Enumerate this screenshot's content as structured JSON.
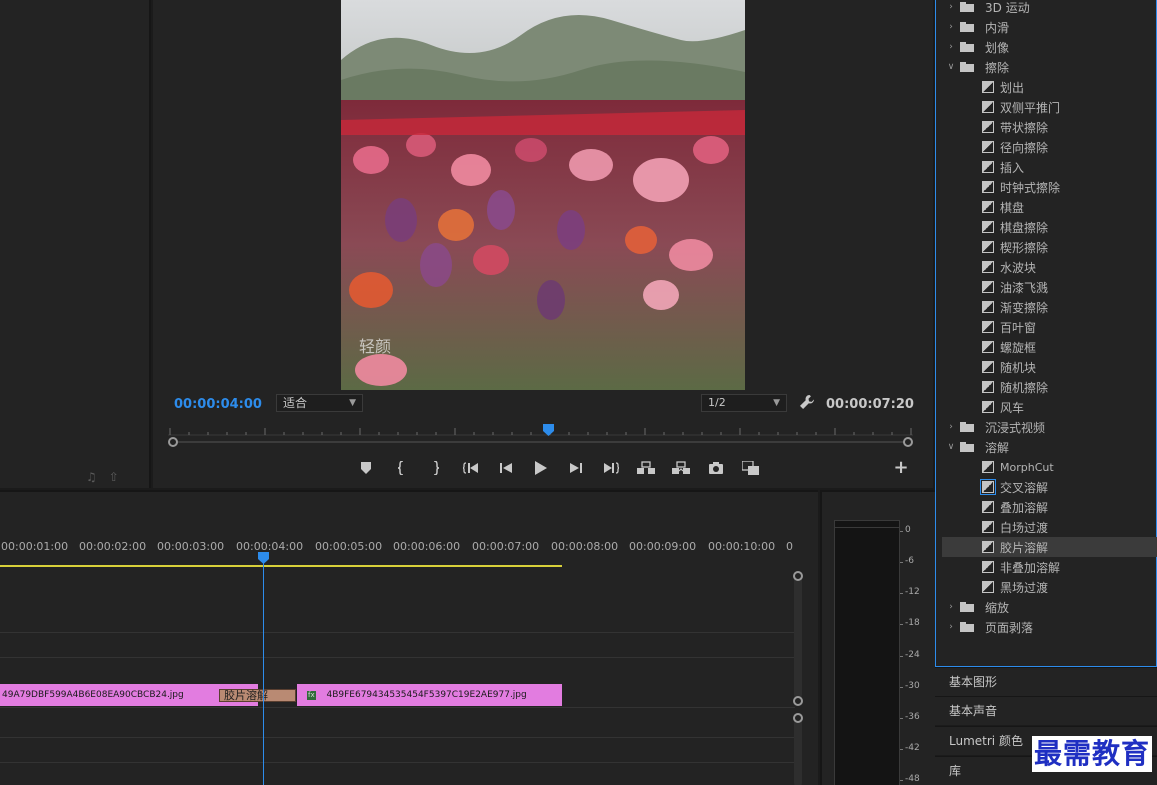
{
  "program_monitor": {
    "current_timecode": "00:00:04:00",
    "duration_timecode": "00:00:07:20",
    "zoom_select": "适合",
    "resolution_select": "1/2",
    "frame_watermark": "轻颜"
  },
  "timeline": {
    "ruler_labels": [
      "00:00:01:00",
      "00:00:02:00",
      "00:00:03:00",
      "00:00:04:00",
      "00:00:05:00",
      "00:00:06:00",
      "00:00:07:00",
      "00:00:08:00",
      "00:00:09:00",
      "00:00:10:00",
      "0"
    ],
    "clip_a": "49A79DBF599A4B6E08EA90CBCB24.jpg",
    "clip_b": "4B9FE679434535454F5397C19E2AE977.jpg",
    "clip_b_fx": "fx",
    "transition_label": "胶片溶解"
  },
  "audio_meter": {
    "db_labels": [
      "0",
      "-6",
      "-12",
      "-18",
      "-24",
      "-30",
      "-36",
      "-42",
      "-48"
    ]
  },
  "effects": {
    "items": [
      {
        "label": "3D 运动",
        "type": "folder",
        "expanded": false
      },
      {
        "label": "内滑",
        "type": "folder",
        "expanded": false
      },
      {
        "label": "划像",
        "type": "folder",
        "expanded": false
      },
      {
        "label": "擦除",
        "type": "folder",
        "expanded": true
      },
      {
        "label": "划出",
        "type": "effect"
      },
      {
        "label": "双侧平推门",
        "type": "effect"
      },
      {
        "label": "带状擦除",
        "type": "effect"
      },
      {
        "label": "径向擦除",
        "type": "effect"
      },
      {
        "label": "插入",
        "type": "effect"
      },
      {
        "label": "时钟式擦除",
        "type": "effect"
      },
      {
        "label": "棋盘",
        "type": "effect"
      },
      {
        "label": "棋盘擦除",
        "type": "effect"
      },
      {
        "label": "楔形擦除",
        "type": "effect"
      },
      {
        "label": "水波块",
        "type": "effect"
      },
      {
        "label": "油漆飞溅",
        "type": "effect"
      },
      {
        "label": "渐变擦除",
        "type": "effect"
      },
      {
        "label": "百叶窗",
        "type": "effect"
      },
      {
        "label": "螺旋框",
        "type": "effect"
      },
      {
        "label": "随机块",
        "type": "effect"
      },
      {
        "label": "随机擦除",
        "type": "effect"
      },
      {
        "label": "风车",
        "type": "effect"
      },
      {
        "label": "沉浸式视频",
        "type": "folder",
        "expanded": false
      },
      {
        "label": "溶解",
        "type": "folder",
        "expanded": true
      },
      {
        "label": "MorphCut",
        "type": "effect"
      },
      {
        "label": "交叉溶解",
        "type": "effect",
        "default": true
      },
      {
        "label": "叠加溶解",
        "type": "effect"
      },
      {
        "label": "白场过渡",
        "type": "effect"
      },
      {
        "label": "胶片溶解",
        "type": "effect",
        "selected": true
      },
      {
        "label": "非叠加溶解",
        "type": "effect"
      },
      {
        "label": "黑场过渡",
        "type": "effect"
      },
      {
        "label": "缩放",
        "type": "folder",
        "expanded": false
      },
      {
        "label": "页面剥落",
        "type": "folder",
        "expanded": false
      }
    ]
  },
  "panel_tabs": {
    "essential_graphics": "基本图形",
    "essential_sound": "基本声音",
    "lumetri_color": "Lumetri 颜色",
    "libraries": "库"
  },
  "watermark": "最需教育",
  "colors": {
    "accent": "#2d8ceb",
    "clip": "#e27ce0",
    "work_area": "#d8d03a",
    "transition": "#b98a73"
  }
}
